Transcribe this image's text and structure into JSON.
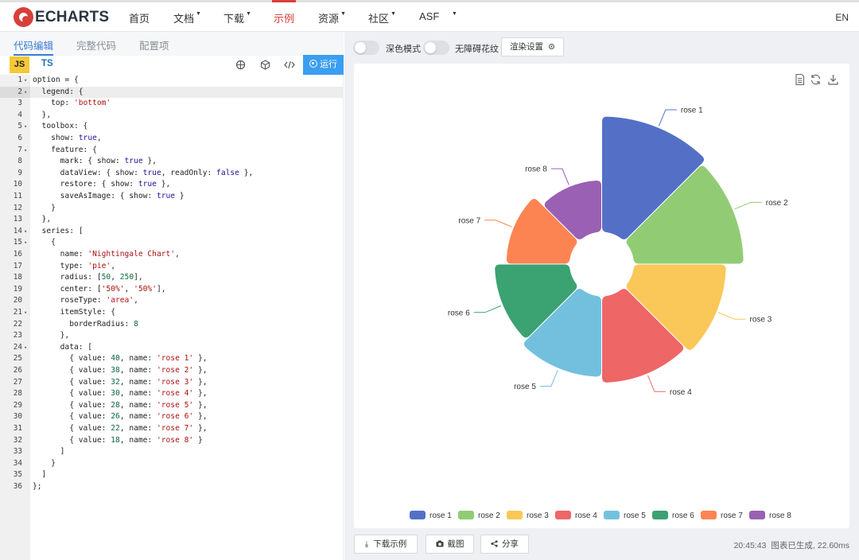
{
  "nav": {
    "logo_text": "ECHARTS",
    "items": [
      {
        "label": "首页",
        "caret": false
      },
      {
        "label": "文档",
        "caret": true
      },
      {
        "label": "下载",
        "caret": true
      },
      {
        "label": "示例",
        "caret": false,
        "active": true
      },
      {
        "label": "资源",
        "caret": true
      },
      {
        "label": "社区",
        "caret": true
      },
      {
        "label": "ASF",
        "caret": true
      }
    ],
    "lang": "EN"
  },
  "editor": {
    "tabs": [
      "代码编辑",
      "完整代码",
      "配置项"
    ],
    "active_tab": "代码编辑",
    "js_label": "JS",
    "ts_label": "TS",
    "run_label": "运行",
    "code_lines": [
      "option = {",
      "  legend: {",
      "    top: 'bottom'",
      "  },",
      "  toolbox: {",
      "    show: true,",
      "    feature: {",
      "      mark: { show: true },",
      "      dataView: { show: true, readOnly: false },",
      "      restore: { show: true },",
      "      saveAsImage: { show: true }",
      "    }",
      "  },",
      "  series: [",
      "    {",
      "      name: 'Nightingale Chart',",
      "      type: 'pie',",
      "      radius: [50, 250],",
      "      center: ['50%', '50%'],",
      "      roseType: 'area',",
      "      itemStyle: {",
      "        borderRadius: 8",
      "      },",
      "      data: [",
      "        { value: 40, name: 'rose 1' },",
      "        { value: 38, name: 'rose 2' },",
      "        { value: 32, name: 'rose 3' },",
      "        { value: 30, name: 'rose 4' },",
      "        { value: 28, name: 'rose 5' },",
      "        { value: 26, name: 'rose 6' },",
      "        { value: 22, name: 'rose 7' },",
      "        { value: 18, name: 'rose 8' }",
      "      ]",
      "    }",
      "  ]",
      "};"
    ],
    "fold_lines": [
      1,
      2,
      5,
      7,
      14,
      15,
      21,
      24
    ]
  },
  "preview": {
    "dark_mode_label": "深色模式",
    "a11y_label": "无障碍花纹",
    "render_settings_label": "渲染设置",
    "download_label": "下载示例",
    "screenshot_label": "截图",
    "share_label": "分享",
    "time": "20:45:43",
    "status_text": "图表已生成, 22.60ms"
  },
  "chart_data": {
    "type": "pie",
    "roseType": "area",
    "series_name": "Nightingale Chart",
    "radius": [
      50,
      250
    ],
    "legend_position": "bottom",
    "categories": [
      "rose 1",
      "rose 2",
      "rose 3",
      "rose 4",
      "rose 5",
      "rose 6",
      "rose 7",
      "rose 8"
    ],
    "values": [
      40,
      38,
      32,
      30,
      28,
      26,
      22,
      18
    ],
    "colors": [
      "#5470c6",
      "#91cc75",
      "#fac858",
      "#ee6666",
      "#73c0de",
      "#3ba272",
      "#fc8452",
      "#9a60b4"
    ]
  }
}
